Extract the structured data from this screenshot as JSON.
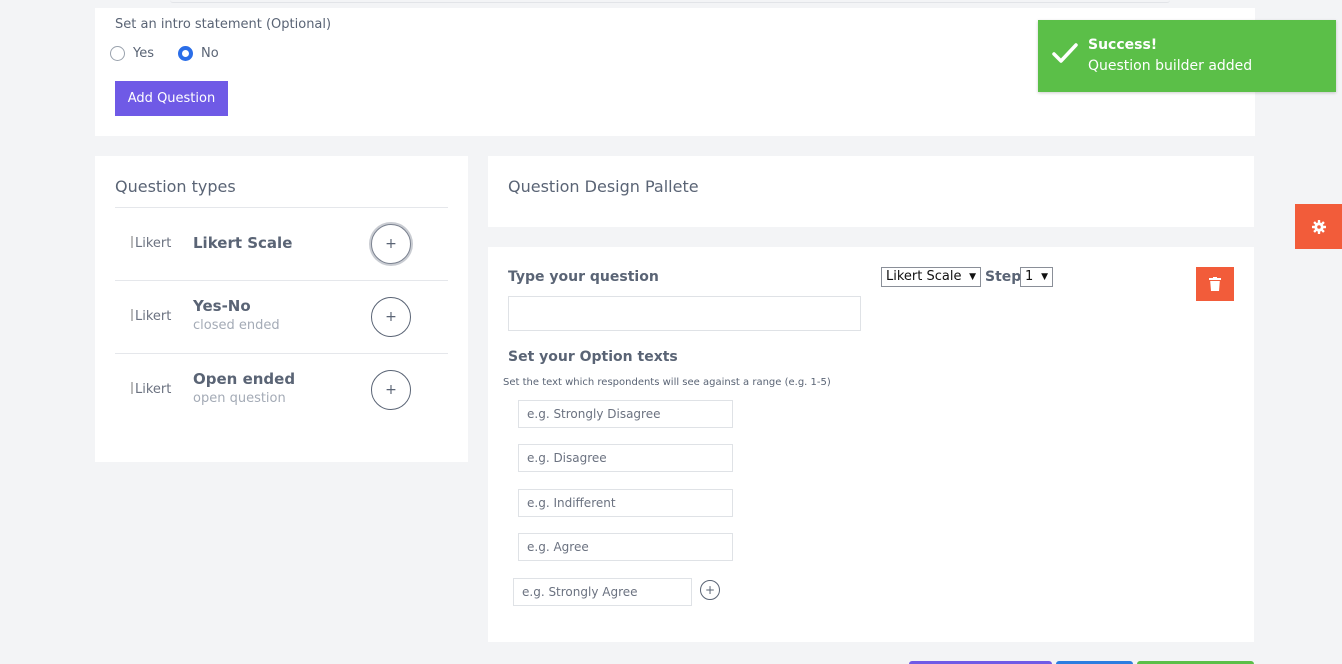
{
  "intro": {
    "label": "Set an intro statement (Optional)",
    "options": [
      {
        "label": "Yes",
        "checked": false
      },
      {
        "label": "No",
        "checked": true
      }
    ],
    "add_button": "Add Question"
  },
  "question_types": {
    "title": "Question types",
    "items": [
      {
        "img_alt": "Likert",
        "name": "Likert Scale",
        "subtitle": ""
      },
      {
        "img_alt": "Likert",
        "name": "Yes-No",
        "subtitle": "closed ended"
      },
      {
        "img_alt": "Likert",
        "name": "Open ended",
        "subtitle": "open question"
      }
    ],
    "add_symbol": "+"
  },
  "pallete": {
    "title": "Question Design Pallete"
  },
  "builder": {
    "question_label": "Type your question",
    "question_value": "",
    "type_select": "Likert Scale",
    "step_label": "Step",
    "step_select": "1",
    "options_title": "Set your Option texts",
    "options_hint": "Set the text which respondents will see against a range (e.g. 1-5)",
    "option_placeholders": [
      "e.g. Strongly Disagree",
      "e.g. Disagree",
      "e.g. Indifferent",
      "e.g. Agree",
      "e.g. Strongly Agree"
    ],
    "add_option_symbol": "+"
  },
  "toast": {
    "title": "Success!",
    "message": "Question builder added"
  },
  "colors": {
    "primary": "#6f5ae6",
    "danger": "#f25c3a",
    "success": "#5bbf48",
    "radio": "#2b6ee8"
  },
  "icons": {
    "delete": "trash-icon",
    "settings": "gear-icon",
    "toast": "checkmark-icon"
  }
}
